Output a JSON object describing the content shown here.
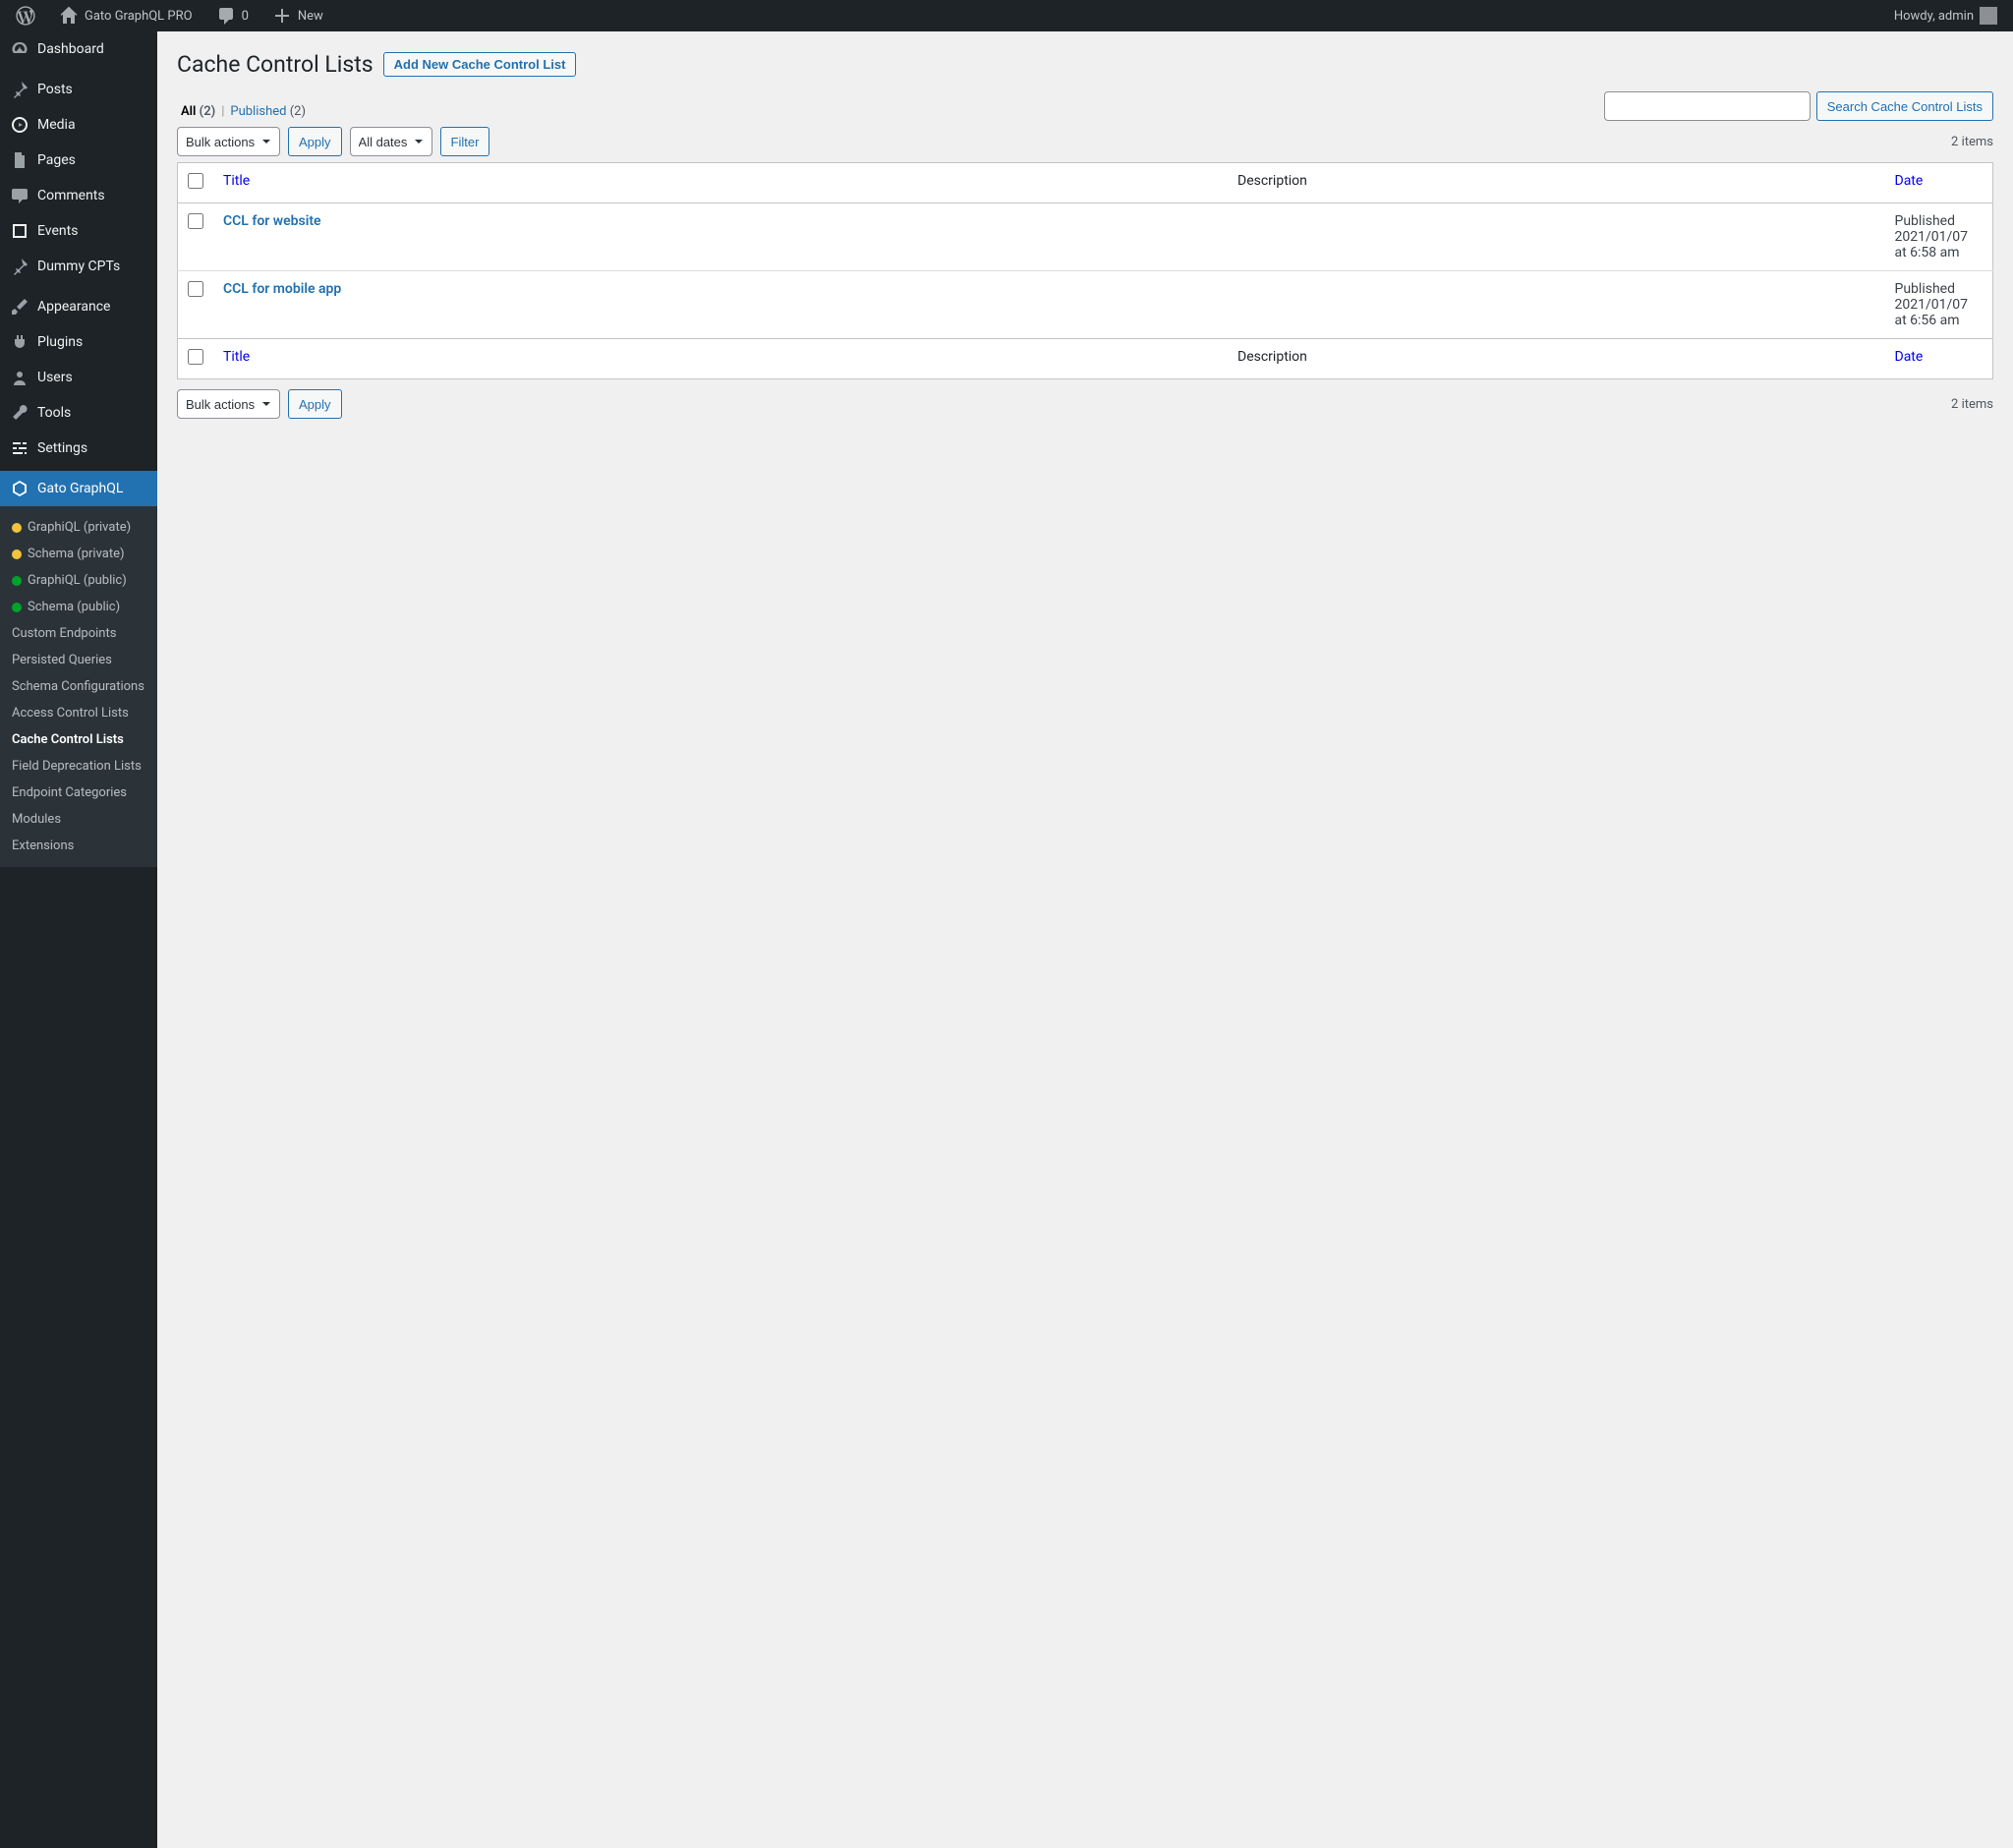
{
  "adminbar": {
    "site_title": "Gato GraphQL PRO",
    "comments_count": "0",
    "new_label": "New",
    "howdy": "Howdy, admin"
  },
  "sidebar": {
    "items": [
      {
        "label": "Dashboard"
      },
      {
        "label": "Posts"
      },
      {
        "label": "Media"
      },
      {
        "label": "Pages"
      },
      {
        "label": "Comments"
      },
      {
        "label": "Events"
      },
      {
        "label": "Dummy CPTs"
      },
      {
        "label": "Appearance"
      },
      {
        "label": "Plugins"
      },
      {
        "label": "Users"
      },
      {
        "label": "Tools"
      },
      {
        "label": "Settings"
      },
      {
        "label": "Gato GraphQL"
      }
    ],
    "submenu": [
      {
        "label": "GraphiQL (private)",
        "dot": "yellow"
      },
      {
        "label": "Schema (private)",
        "dot": "yellow"
      },
      {
        "label": "GraphiQL (public)",
        "dot": "green"
      },
      {
        "label": "Schema (public)",
        "dot": "green"
      },
      {
        "label": "Custom Endpoints"
      },
      {
        "label": "Persisted Queries"
      },
      {
        "label": "Schema Configurations"
      },
      {
        "label": "Access Control Lists"
      },
      {
        "label": "Cache Control Lists",
        "current": true
      },
      {
        "label": "Field Deprecation Lists"
      },
      {
        "label": "Endpoint Categories"
      },
      {
        "label": "Modules"
      },
      {
        "label": "Extensions"
      }
    ]
  },
  "page": {
    "title": "Cache Control Lists",
    "add_new": "Add New Cache Control List"
  },
  "filters": {
    "all_label": "All",
    "all_count": "(2)",
    "published_label": "Published",
    "published_count": "(2)",
    "bulk_actions": "Bulk actions",
    "apply": "Apply",
    "all_dates": "All dates",
    "filter": "Filter",
    "search_button": "Search Cache Control Lists",
    "items_count": "2 items"
  },
  "columns": {
    "title": "Title",
    "description": "Description",
    "date": "Date"
  },
  "rows": [
    {
      "title": "CCL for website",
      "status": "Published",
      "date": "2021/01/07 at 6:58 am"
    },
    {
      "title": "CCL for mobile app",
      "status": "Published",
      "date": "2021/01/07 at 6:56 am"
    }
  ]
}
